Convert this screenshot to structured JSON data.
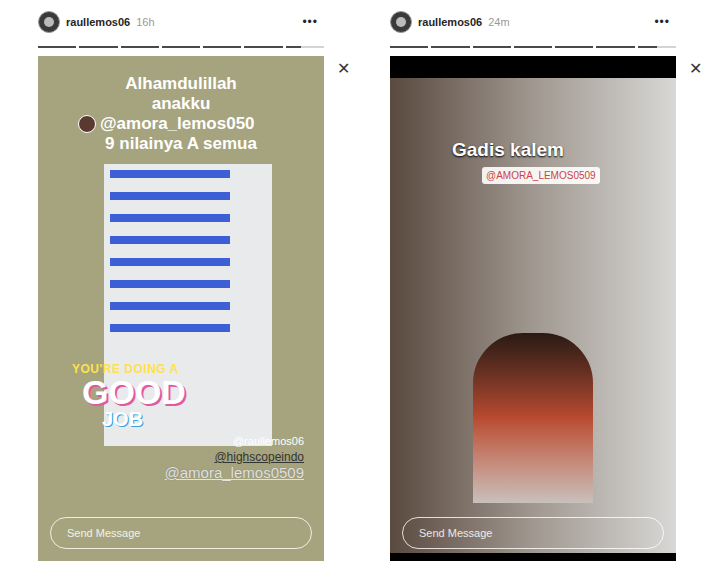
{
  "stories": [
    {
      "kind": "report",
      "username": "raullemos06",
      "time": "16h",
      "more": "•••",
      "close": "✕",
      "segments": [
        {
          "level": 1
        },
        {
          "level": 1
        },
        {
          "level": 1
        },
        {
          "level": 1
        },
        {
          "level": 1
        },
        {
          "level": 1
        },
        {
          "level": 0.4
        }
      ],
      "caption_lines": [
        "Alhamdulillah",
        "anakku"
      ],
      "caption_mention": "@amora_lemos050",
      "caption_end": "9 nilainya A semua",
      "sticker": [
        "YOU'RE DOING A",
        "GOOD",
        "JOB"
      ],
      "tags": [
        "@raullemos06",
        "@highscopeindo",
        "@amora_lemos0509"
      ],
      "reply": {
        "placeholder": "Send Message"
      }
    },
    {
      "kind": "photo",
      "username": "raullemos06",
      "time": "24m",
      "more": "•••",
      "close": "✕",
      "segments": [
        {
          "level": 1
        },
        {
          "level": 1
        },
        {
          "level": 1
        },
        {
          "level": 1
        },
        {
          "level": 1
        },
        {
          "level": 1
        },
        {
          "level": 0.5
        }
      ],
      "caption_lines": [
        "Gadis kalem"
      ],
      "tags": [
        "@AMORA_LEMOS0509"
      ],
      "reply": {
        "placeholder": "Send Message"
      }
    }
  ]
}
